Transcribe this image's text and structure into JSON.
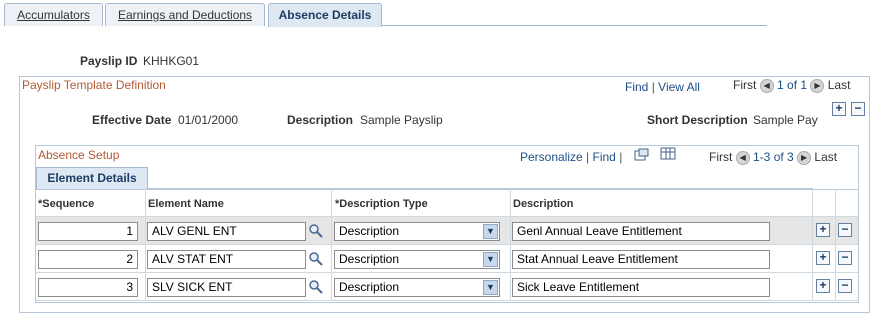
{
  "tabs": [
    {
      "label": "Accumulators"
    },
    {
      "label": "Earnings and Deductions"
    },
    {
      "label": "Absence Details"
    }
  ],
  "payslip": {
    "label": "Payslip ID",
    "value": "KHHKG01"
  },
  "template_section": {
    "title": "Payslip Template Definition",
    "find": "Find",
    "separator": "|",
    "view_all": "View All",
    "first": "First",
    "range": "1 of 1",
    "last": "Last",
    "effective_date_label": "Effective Date",
    "effective_date": "01/01/2000",
    "description_label": "Description",
    "description": "Sample Payslip",
    "short_description_label": "Short Description",
    "short_description": "Sample Pay"
  },
  "absence_setup": {
    "title": "Absence Setup",
    "personalize": "Personalize",
    "separator": "|",
    "find": "Find",
    "first": "First",
    "range": "1-3 of 3",
    "last": "Last",
    "subtab": "Element Details",
    "columns": {
      "sequence": "*Sequence",
      "element_name": "Element Name",
      "description_type": "*Description Type",
      "description": "Description"
    },
    "rows": [
      {
        "sequence": "1",
        "element": "ALV GENL ENT",
        "desc_type": "Description",
        "description": "Genl Annual Leave Entitlement"
      },
      {
        "sequence": "2",
        "element": "ALV STAT ENT",
        "desc_type": "Description",
        "description": "Stat Annual Leave Entitlement"
      },
      {
        "sequence": "3",
        "element": "SLV SICK ENT",
        "desc_type": "Description",
        "description": "Sick Leave Entitlement"
      }
    ]
  },
  "icons": {
    "add": "+",
    "remove": "−",
    "prev": "◀",
    "next": "▶",
    "dropdown": "▼"
  }
}
